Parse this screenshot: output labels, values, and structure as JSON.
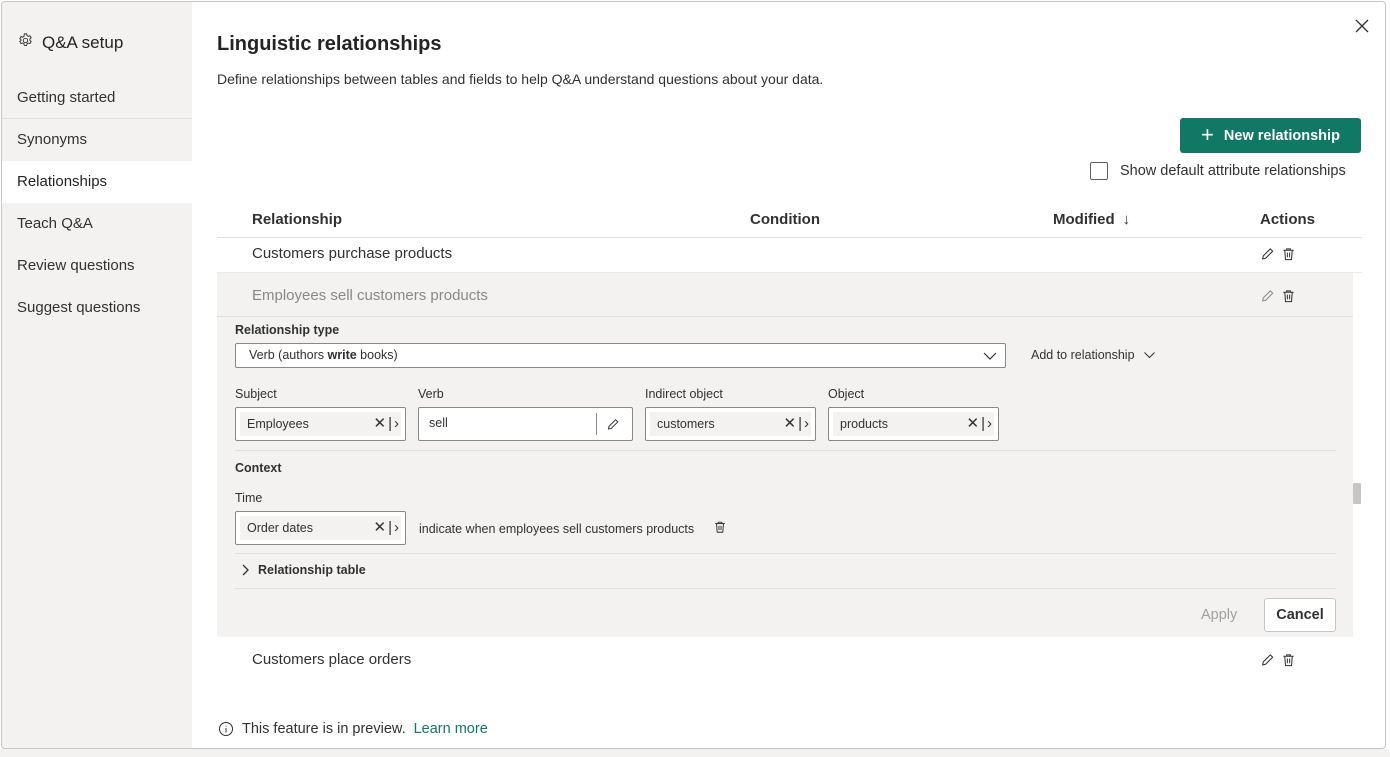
{
  "sidebar": {
    "title": "Q&A setup",
    "items": [
      {
        "label": "Getting started"
      },
      {
        "label": "Synonyms"
      },
      {
        "label": "Relationships"
      },
      {
        "label": "Teach Q&A"
      },
      {
        "label": "Review questions"
      },
      {
        "label": "Suggest questions"
      }
    ],
    "active_item": "Relationships"
  },
  "main": {
    "title": "Linguistic relationships",
    "description": "Define relationships between tables and fields to help Q&A understand questions about your data.",
    "new_button_label": "New relationship",
    "show_default_label": "Show default attribute relationships",
    "show_default_checked": false
  },
  "table": {
    "headers": {
      "relationship": "Relationship",
      "condition": "Condition",
      "modified": "Modified",
      "actions": "Actions"
    },
    "sort_indicator": "↓",
    "rows": [
      {
        "relationship": "Customers purchase products"
      },
      {
        "relationship": "Employees sell customers products",
        "expanded": true
      },
      {
        "relationship": "Customers place orders"
      }
    ]
  },
  "editor": {
    "relationship_type_label": "Relationship type",
    "relationship_type_prefix": "Verb (authors ",
    "relationship_type_bold": "write",
    "relationship_type_suffix": " books)",
    "add_to_relationship": "Add to relationship",
    "subject_label": "Subject",
    "subject_value": "Employees",
    "verb_label": "Verb",
    "verb_value": "sell",
    "indirect_object_label": "Indirect object",
    "indirect_object_value": "customers",
    "object_label": "Object",
    "object_value": "products",
    "context_label": "Context",
    "time_label": "Time",
    "time_value": "Order dates",
    "time_description": "indicate when employees sell customers products",
    "relationship_table_label": "Relationship table",
    "apply_label": "Apply",
    "cancel_label": "Cancel"
  },
  "footer": {
    "text": "This feature is in preview.",
    "link": "Learn more"
  },
  "colors": {
    "accent": "#117865",
    "sidebar_bg": "#f3f2f1",
    "expanded_bg": "#f3f2f1"
  }
}
